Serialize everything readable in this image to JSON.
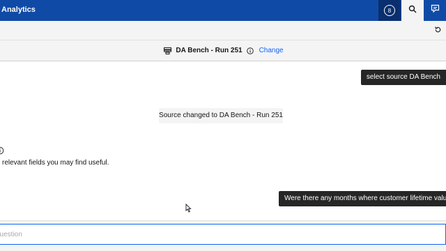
{
  "header": {
    "app_title": "Analytics",
    "notifications_count": "8",
    "icons": [
      "notification-badge",
      "search-icon",
      "chat-icon"
    ]
  },
  "toolbar": {
    "icons": [
      "reset-icon"
    ]
  },
  "source_bar": {
    "source_name": "DA Bench - Run 251",
    "change_label": "Change",
    "icons": [
      "data-source-icon",
      "info-icon"
    ]
  },
  "chat": {
    "user_message_1": "select source DA Bench",
    "system_message": "Source changed to DA Bench - Run 251",
    "assistant_text": "relevant fields you may find useful.",
    "user_message_2": "Were there any months where customer lifetime value in"
  },
  "input": {
    "placeholder": "question"
  },
  "colors": {
    "header_bg": "#0f4ba6",
    "accent": "#0f62fe",
    "bubble_bg": "#262626"
  }
}
